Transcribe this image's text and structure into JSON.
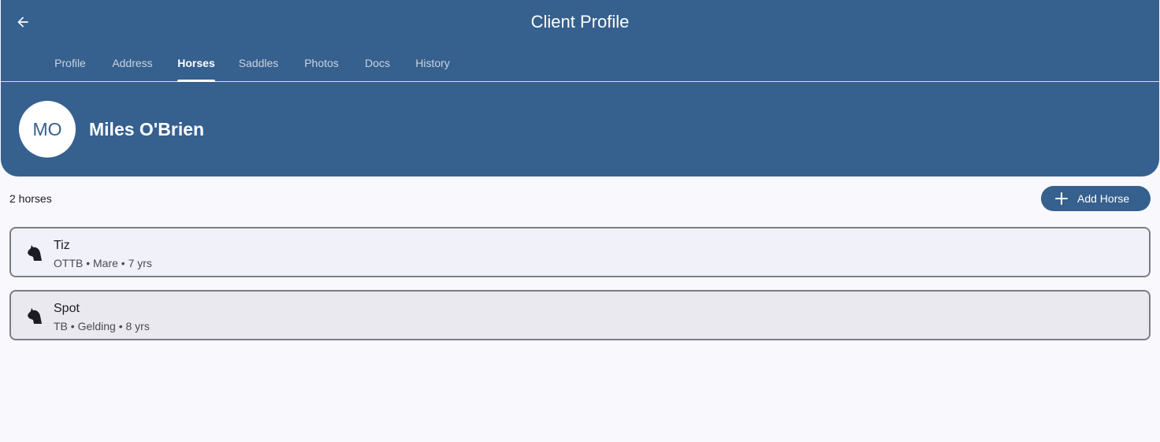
{
  "header": {
    "title": "Client Profile",
    "back_icon": "arrow-left-icon",
    "tabs": [
      {
        "label": "Profile",
        "active": false
      },
      {
        "label": "Address",
        "active": false
      },
      {
        "label": "Horses",
        "active": true
      },
      {
        "label": "Saddles",
        "active": false
      },
      {
        "label": "Photos",
        "active": false
      },
      {
        "label": "Docs",
        "active": false
      },
      {
        "label": "History",
        "active": false
      }
    ]
  },
  "client": {
    "initials": "MO",
    "name": "Miles O'Brien"
  },
  "horses_section": {
    "count_label": "2 horses",
    "add_button_label": "Add Horse",
    "add_icon": "plus-icon",
    "items": [
      {
        "name": "Tiz",
        "details": "OTTB • Mare • 7 yrs",
        "icon": "horse-head-icon"
      },
      {
        "name": "Spot",
        "details": "TB • Gelding • 8 yrs",
        "icon": "horse-head-icon"
      }
    ]
  },
  "colors": {
    "primary": "#36608e",
    "background": "#f8f8fd",
    "card": "#f1f2f9",
    "card_alt": "#e9e9ef",
    "card_border": "#7d7d86"
  }
}
